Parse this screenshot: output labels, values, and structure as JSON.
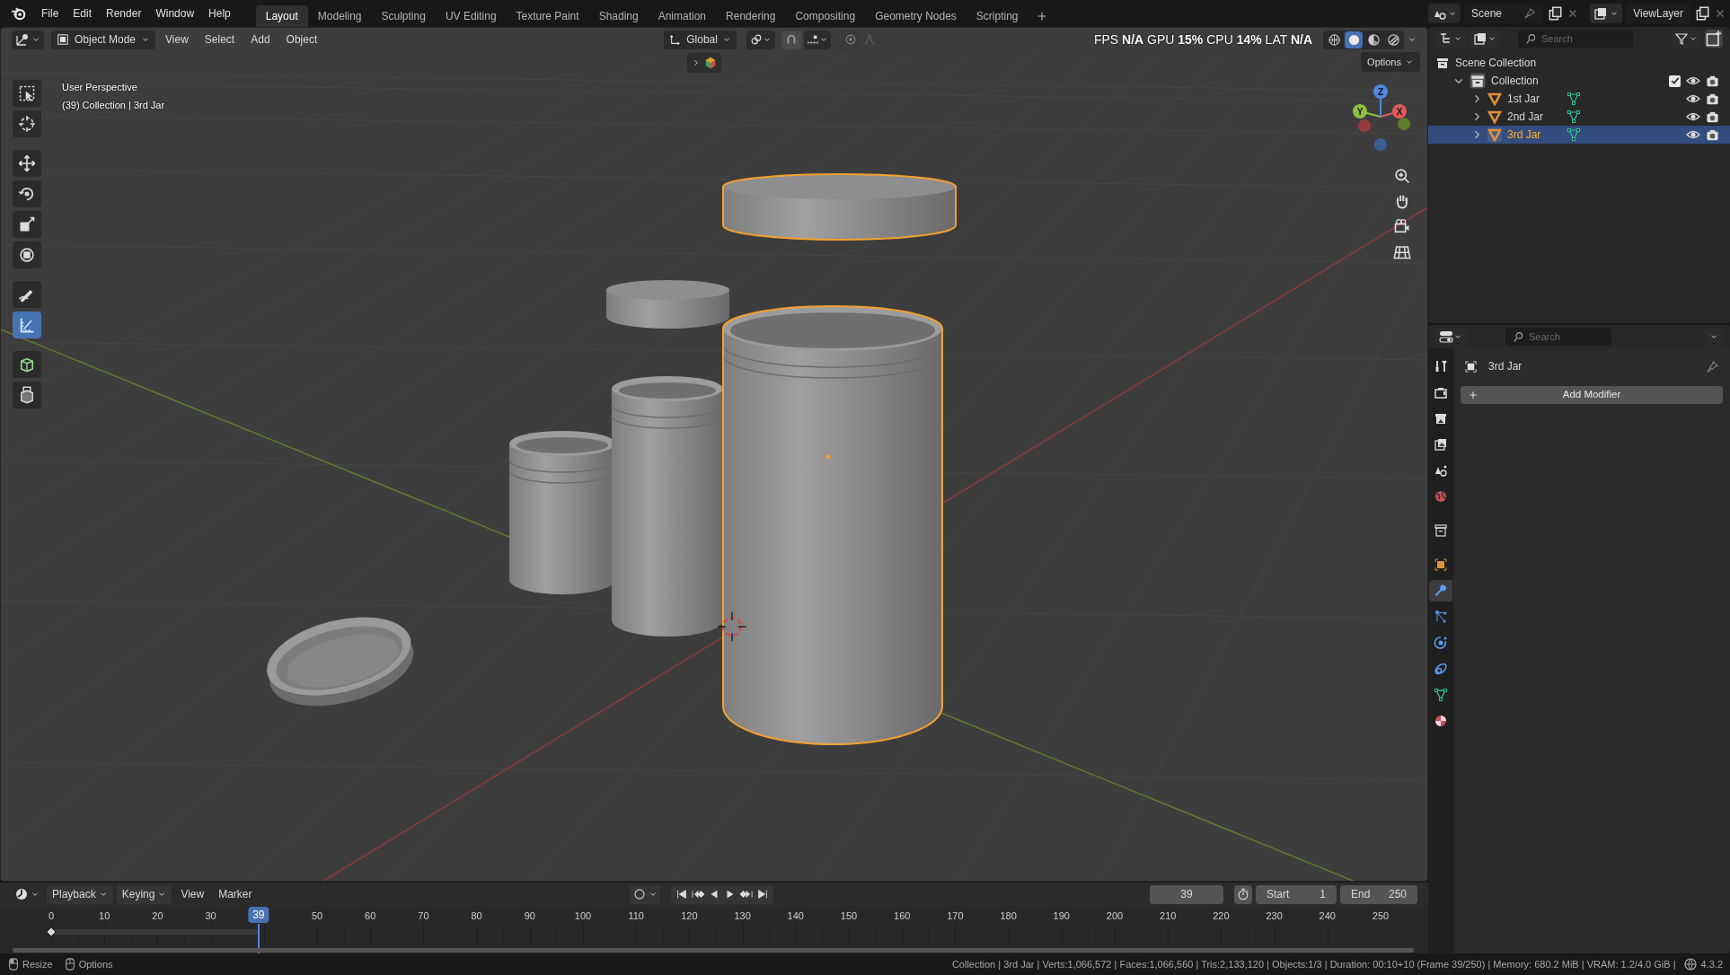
{
  "top_menu": [
    "File",
    "Edit",
    "Render",
    "Window",
    "Help"
  ],
  "workspaces": [
    {
      "label": "Layout",
      "selected": true
    },
    {
      "label": "Modeling",
      "selected": false
    },
    {
      "label": "Sculpting",
      "selected": false
    },
    {
      "label": "UV Editing",
      "selected": false
    },
    {
      "label": "Texture Paint",
      "selected": false
    },
    {
      "label": "Shading",
      "selected": false
    },
    {
      "label": "Animation",
      "selected": false
    },
    {
      "label": "Rendering",
      "selected": false
    },
    {
      "label": "Compositing",
      "selected": false
    },
    {
      "label": "Geometry Nodes",
      "selected": false
    },
    {
      "label": "Scripting",
      "selected": false
    }
  ],
  "scene": "Scene",
  "view_layer": "ViewLayer",
  "viewport": {
    "mode": "Object Mode",
    "menus": [
      "View",
      "Select",
      "Add",
      "Object"
    ],
    "orientation": "Global",
    "stats": "FPS **N/A** GPU **15%** CPU **14%** LAT **N/A**",
    "shading": [
      {
        "kind": "wireframe",
        "selected": false
      },
      {
        "kind": "solid",
        "selected": true
      },
      {
        "kind": "material",
        "selected": false
      },
      {
        "kind": "rendered",
        "selected": false
      }
    ],
    "gizmo_toggle": {
      "expanded": false
    },
    "options": "Options",
    "view_name": "User Perspective",
    "view_info": "(39) Collection | 3rd Jar",
    "gizmo_axes": [
      "X",
      "Y",
      "Z"
    ],
    "tools": [
      {
        "kind": "select",
        "selected": false
      },
      {
        "kind": "cursor",
        "selected": false
      },
      {
        "kind": "move",
        "selected": false
      },
      {
        "kind": "rotate",
        "selected": false
      },
      {
        "kind": "scale",
        "selected": false
      },
      {
        "kind": "transform",
        "selected": false
      },
      {
        "kind": "annotate",
        "selected": false
      },
      {
        "kind": "measure",
        "selected": true
      },
      {
        "kind": "add-cube",
        "selected": false
      },
      {
        "kind": "extrude",
        "selected": false
      }
    ]
  },
  "outliner": {
    "search_placeholder": "Search",
    "tree": [
      {
        "label": "Scene Collection",
        "kind": "scene",
        "selected": false,
        "children": [
          {
            "label": "Collection",
            "kind": "collection",
            "selected": false,
            "expanded": true,
            "checked": true,
            "children": [
              {
                "label": "1st Jar",
                "kind": "mesh",
                "selected": false,
                "expanded": false
              },
              {
                "label": "2nd Jar",
                "kind": "mesh",
                "selected": false,
                "expanded": false
              },
              {
                "label": "3rd Jar",
                "kind": "mesh",
                "selected": true,
                "expanded": false
              }
            ]
          }
        ]
      }
    ]
  },
  "properties": {
    "search_placeholder": "Search",
    "object_name": "3rd Jar",
    "add_button": "Add Modifier",
    "tabs": [
      {
        "kind": "tool",
        "selected": false
      },
      {
        "kind": "render",
        "selected": false
      },
      {
        "kind": "output",
        "selected": false
      },
      {
        "kind": "view-layer",
        "selected": false
      },
      {
        "kind": "scene",
        "selected": false
      },
      {
        "kind": "world",
        "selected": false
      },
      {
        "kind": "collection",
        "selected": false
      },
      {
        "kind": "object",
        "selected": false
      },
      {
        "kind": "modifier",
        "selected": true
      },
      {
        "kind": "particles",
        "selected": false
      },
      {
        "kind": "physics",
        "selected": false
      },
      {
        "kind": "constraints",
        "selected": false
      },
      {
        "kind": "data",
        "selected": false
      },
      {
        "kind": "material",
        "selected": false
      }
    ]
  },
  "timeline": {
    "menus": [
      "Playback",
      "Keying",
      "View",
      "Marker"
    ],
    "current_frame": "39",
    "playhead_label": "39",
    "start_label": "Start",
    "start": "1",
    "end_label": "End",
    "end": "250",
    "ticks": [
      "0",
      "10",
      "20",
      "30",
      "50",
      "60",
      "70",
      "80",
      "90",
      "100",
      "110",
      "120",
      "130",
      "140",
      "150",
      "160",
      "170",
      "180",
      "190",
      "200",
      "210",
      "220",
      "230",
      "240",
      "250"
    ]
  },
  "status_bar": {
    "hints": [
      "Resize",
      "Options"
    ],
    "info": "Collection | 3rd Jar | Verts:1,066,572 | Faces:1,066,560 | Tris:2,133,120 | Objects:1/3 | Duration: 00:10+10 (Frame 39/250) | Memory: 680.2 MiB | VRAM: 1.2/4.0 GiB |",
    "version": "4.3.2"
  }
}
